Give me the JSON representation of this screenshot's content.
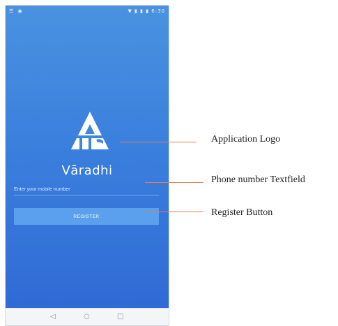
{
  "status_bar": {
    "left_icons": "☰ ◉",
    "right_icons": "▼ ▮ ▮ ▮ 6:30"
  },
  "app": {
    "name": "Vāradhi",
    "phone_placeholder": "Enter your mobile number",
    "register_label": "REGISTER"
  },
  "nav_bar": {
    "back": "◁",
    "home": "○",
    "recents": "□"
  },
  "callouts": {
    "logo": "Application Logo",
    "phone_field": "Phone number Textfield",
    "register": "Register Button"
  },
  "icons": {
    "logo": "itc-logo-icon",
    "back": "back-icon",
    "home": "home-icon",
    "recents": "recents-icon"
  },
  "colors": {
    "gradient_top": "#4a92e0",
    "gradient_bottom": "#2f68d4",
    "button": "#5aa0ec",
    "callout_line": "#e07e52"
  }
}
